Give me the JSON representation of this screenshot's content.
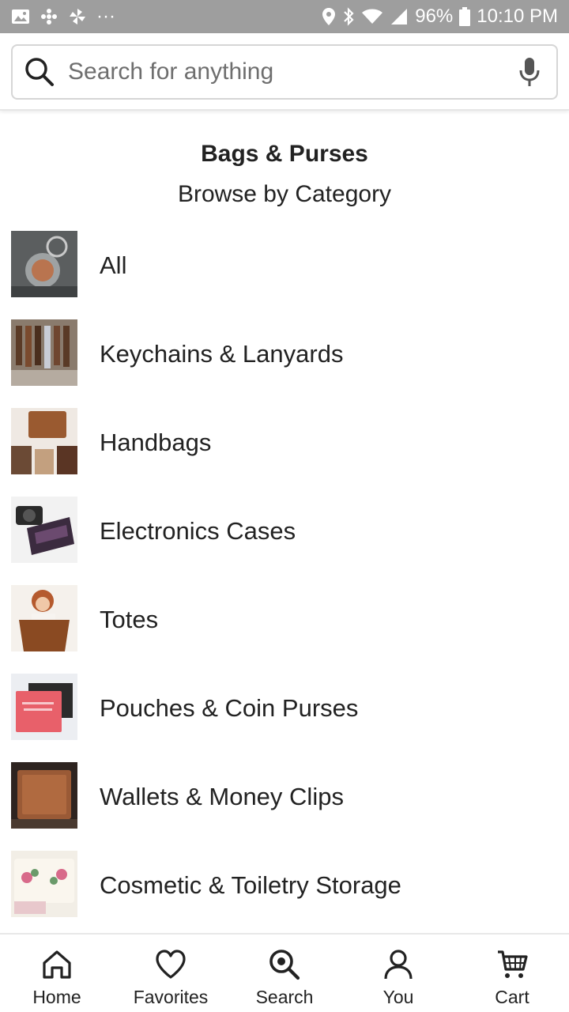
{
  "status_bar": {
    "battery": "96%",
    "time": "10:10 PM",
    "more": "···"
  },
  "search": {
    "placeholder": "Search for anything"
  },
  "page": {
    "title": "Bags & Purses",
    "section_title": "Browse by Category"
  },
  "categories": [
    {
      "label": "All"
    },
    {
      "label": "Keychains & Lanyards"
    },
    {
      "label": "Handbags"
    },
    {
      "label": "Electronics Cases"
    },
    {
      "label": "Totes"
    },
    {
      "label": "Pouches & Coin Purses"
    },
    {
      "label": "Wallets & Money Clips"
    },
    {
      "label": "Cosmetic & Toiletry Storage"
    }
  ],
  "bottom_nav": {
    "home": "Home",
    "favorites": "Favorites",
    "search": "Search",
    "you": "You",
    "cart": "Cart"
  },
  "colors": {
    "status_bar": "#9e9e9e",
    "text": "#222222",
    "border": "#d6d6d6"
  }
}
